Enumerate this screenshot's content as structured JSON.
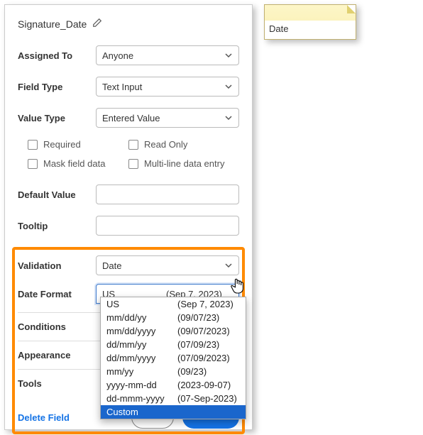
{
  "title": "Signature_Date",
  "rows": {
    "assigned_to": {
      "label": "Assigned To",
      "value": "Anyone"
    },
    "field_type": {
      "label": "Field Type",
      "value": "Text Input"
    },
    "value_type": {
      "label": "Value Type",
      "value": "Entered Value"
    },
    "default_value": {
      "label": "Default Value"
    },
    "tooltip": {
      "label": "Tooltip"
    },
    "validation": {
      "label": "Validation",
      "value": "Date"
    },
    "date_format": {
      "label": "Date Format",
      "value_fmt": "US",
      "value_ex": "(Sep 7, 2023)"
    }
  },
  "checks": {
    "required": "Required",
    "readonly": "Read Only",
    "mask": "Mask field data",
    "multiline": "Multi-line data entry"
  },
  "sections": [
    "Conditions",
    "Appearance",
    "Tools"
  ],
  "bottom": {
    "delete": "Delete Field"
  },
  "dropdown_options": [
    {
      "fmt": "US",
      "ex": "(Sep 7, 2023)"
    },
    {
      "fmt": "mm/dd/yy",
      "ex": "(09/07/23)"
    },
    {
      "fmt": "mm/dd/yyyy",
      "ex": "(09/07/2023)"
    },
    {
      "fmt": "dd/mm/yy",
      "ex": "(07/09/23)"
    },
    {
      "fmt": "dd/mm/yyyy",
      "ex": "(07/09/2023)"
    },
    {
      "fmt": "mm/yy",
      "ex": "(09/23)"
    },
    {
      "fmt": "yyyy-mm-dd",
      "ex": "(2023-09-07)"
    },
    {
      "fmt": "dd-mmm-yyyy",
      "ex": "(07-Sep-2023)"
    },
    {
      "fmt": "Custom",
      "ex": ""
    }
  ],
  "dropdown_highlight": "Custom",
  "date_tab_label": "Date"
}
